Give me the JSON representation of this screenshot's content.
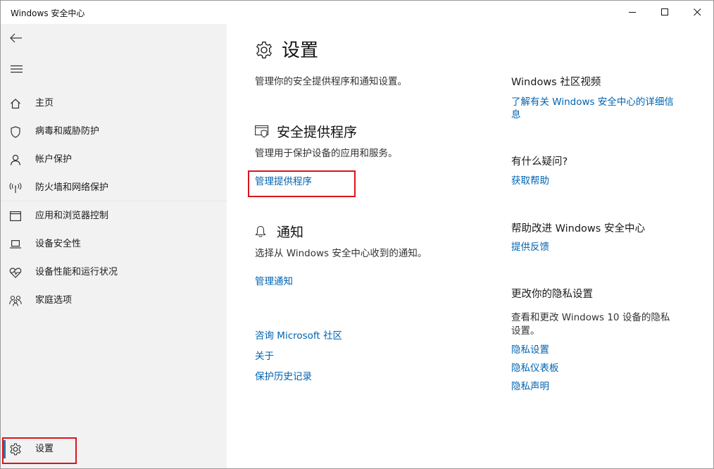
{
  "window": {
    "title": "Windows 安全中心"
  },
  "sidebar": {
    "items": [
      {
        "label": "主页",
        "icon": "home-icon"
      },
      {
        "label": "病毒和威胁防护",
        "icon": "shield-icon"
      },
      {
        "label": "帐户保护",
        "icon": "person-icon"
      },
      {
        "label": "防火墙和网络保护",
        "icon": "wireless-antenna-icon"
      },
      {
        "label": "应用和浏览器控制",
        "icon": "app-window-icon"
      },
      {
        "label": "设备安全性",
        "icon": "laptop-icon"
      },
      {
        "label": "设备性能和运行状况",
        "icon": "heart-pulse-icon"
      },
      {
        "label": "家庭选项",
        "icon": "family-icon"
      }
    ],
    "settings": {
      "label": "设置",
      "icon": "gear-icon"
    }
  },
  "main": {
    "title": "设置",
    "subtitle": "管理你的安全提供程序和通知设置。",
    "providers": {
      "title": "安全提供程序",
      "description": "管理用于保护设备的应用和服务。",
      "link": "管理提供程序"
    },
    "notifications": {
      "title": "通知",
      "description": "选择从 Windows 安全中心收到的通知。",
      "link": "管理通知"
    },
    "footer_links": [
      "咨询 Microsoft 社区",
      "关于",
      "保护历史记录"
    ]
  },
  "right_panel": {
    "video": {
      "heading": "Windows 社区视频",
      "link_line1": "了解有关 Windows 安全中心的详细信",
      "link_line2": "息"
    },
    "question": {
      "heading": "有什么疑问?",
      "link": "获取帮助"
    },
    "improve": {
      "heading": "帮助改进 Windows 安全中心",
      "link": "提供反馈"
    },
    "privacy": {
      "heading": "更改你的隐私设置",
      "text_line1": "查看和更改 Windows 10 设备的隐私",
      "text_line2": "设置。",
      "links": [
        "隐私设置",
        "隐私仪表板",
        "隐私声明"
      ]
    }
  },
  "colors": {
    "link": "#0063b1",
    "highlight": "#d9141b",
    "sidebar_bg": "#f2f2f2",
    "selection_bar": "#3a6ea5"
  }
}
